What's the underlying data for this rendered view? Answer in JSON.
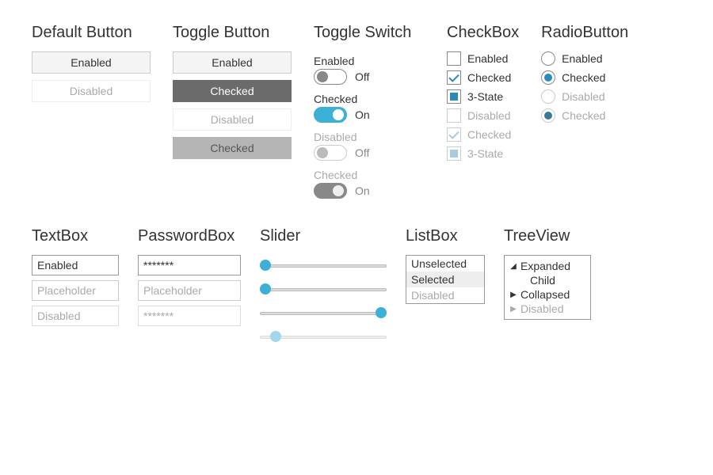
{
  "defaultButton": {
    "title": "Default Button",
    "enabled": "Enabled",
    "disabled": "Disabled"
  },
  "toggleButton": {
    "title": "Toggle Button",
    "enabled": "Enabled",
    "checked": "Checked",
    "disabled": "Disabled",
    "checked_disabled": "Checked"
  },
  "toggleSwitch": {
    "title": "Toggle Switch",
    "labels": {
      "enabled": "Enabled",
      "checked": "Checked",
      "disabled": "Disabled",
      "checked2": "Checked"
    },
    "states": {
      "off": "Off",
      "on": "On"
    }
  },
  "checkbox": {
    "title": "CheckBox",
    "items": [
      "Enabled",
      "Checked",
      "3-State",
      "Disabled",
      "Checked",
      "3-State"
    ]
  },
  "radio": {
    "title": "RadioButton",
    "items": [
      "Enabled",
      "Checked",
      "Disabled",
      "Checked"
    ]
  },
  "textbox": {
    "title": "TextBox",
    "enabled": "Enabled",
    "placeholder": "Placeholder",
    "disabled": "Disabled"
  },
  "passwordbox": {
    "title": "PasswordBox",
    "value": "*******",
    "placeholder": "Placeholder",
    "disabled": "*******"
  },
  "slider": {
    "title": "Slider",
    "positions": [
      0,
      0,
      95,
      8
    ]
  },
  "listbox": {
    "title": "ListBox",
    "items": [
      "Unselected",
      "Selected",
      "Disabled"
    ]
  },
  "treeview": {
    "title": "TreeView",
    "expanded": "Expanded",
    "child": "Child",
    "collapsed": "Collapsed",
    "disabled": "Disabled"
  },
  "colors": {
    "accent": "#3db0d8",
    "accent_dark": "#2a8bbd"
  }
}
